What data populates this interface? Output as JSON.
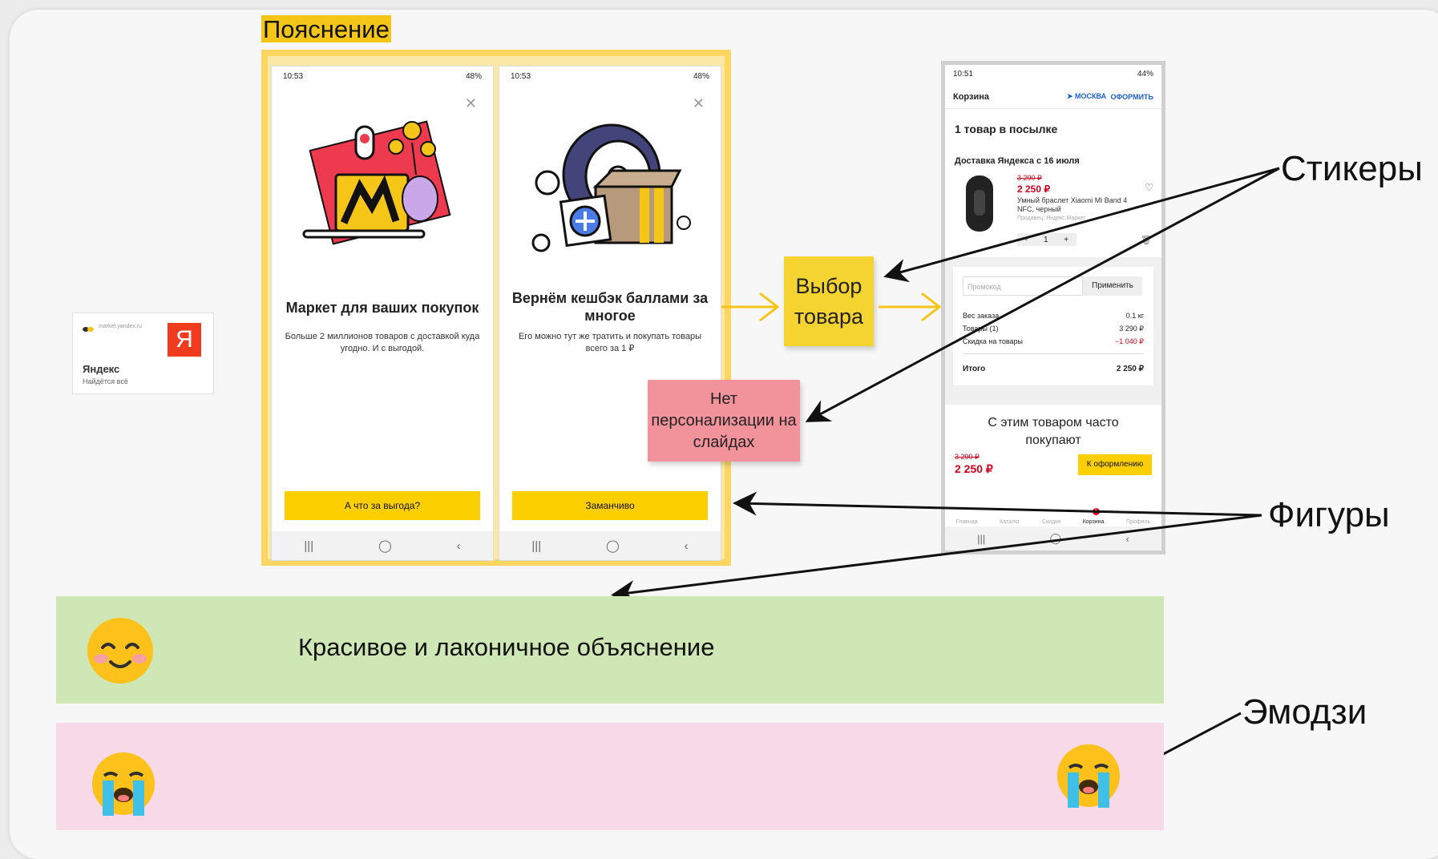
{
  "title_label": "Пояснение",
  "ya_card": {
    "site": "market.yandex.ru",
    "logo_letter": "Я",
    "name": "Яндекс",
    "tagline": "Найдётся всё"
  },
  "slides": [
    {
      "time": "10:53",
      "battery": "48%",
      "title": "Маркет для ваших покупок",
      "text": "Больше 2 миллионов товаров с доставкой куда угодно. И с выгодой.",
      "button": "А что за выгода?"
    },
    {
      "time": "10:53",
      "battery": "48%",
      "title": "Вернём кешбэк баллами за многое",
      "text": "Его можно тут же тратить и покупать товары всего за 1 ₽",
      "button": "Заманчиво"
    }
  ],
  "nav_icons": [
    "|||",
    "◯",
    "‹"
  ],
  "cart": {
    "time": "10:51",
    "battery": "44%",
    "header_title": "Корзина",
    "city": "МОСКВА",
    "checkout_link": "ОФОРМИТЬ",
    "parcel_title": "1 товар в посылке",
    "delivery": "Доставка Яндекса с 16 июля",
    "old_price": "3 290 ₽",
    "price": "2 250 ₽",
    "product_name": "Умный браслет Xiaomi Mi Band 4 NFC, черный",
    "seller": "Продавец: Яндекс.Маркет",
    "qty": "1",
    "minus": "-",
    "plus": "+",
    "promo_placeholder": "Промокод",
    "apply": "Применить",
    "summary": [
      {
        "label": "Вес заказа",
        "value": "0.1 кг"
      },
      {
        "label": "Товары (1)",
        "value": "3 290 ₽"
      },
      {
        "label": "Скидка на товары",
        "value": "−1 040 ₽"
      }
    ],
    "total_label": "Итого",
    "total_value": "2 250 ₽",
    "also_title": "С этим товаром часто покупают",
    "bottom_old_price": "3 290 ₽",
    "bottom_price": "2 250 ₽",
    "bottom_button": "К оформлению",
    "tabs": [
      "Главная",
      "Каталог",
      "Скидки",
      "Корзина",
      "Профиль"
    ],
    "badge": "1"
  },
  "notes": {
    "yellow": "Выбор товара",
    "pink": "Нет персонализации на слайдах"
  },
  "annotations": {
    "stickers": "Стикеры",
    "shapes": "Фигуры",
    "emoji": "Эмодзи"
  },
  "band_text": "Красивое и лаконичное объяснение",
  "colors": {
    "yellow": "#fbcf00",
    "frame": "#fcd660",
    "note_pink": "#f2939b",
    "green": "#cfe7b5",
    "pink": "#f8d9e7",
    "price_red": "#d0021b"
  }
}
